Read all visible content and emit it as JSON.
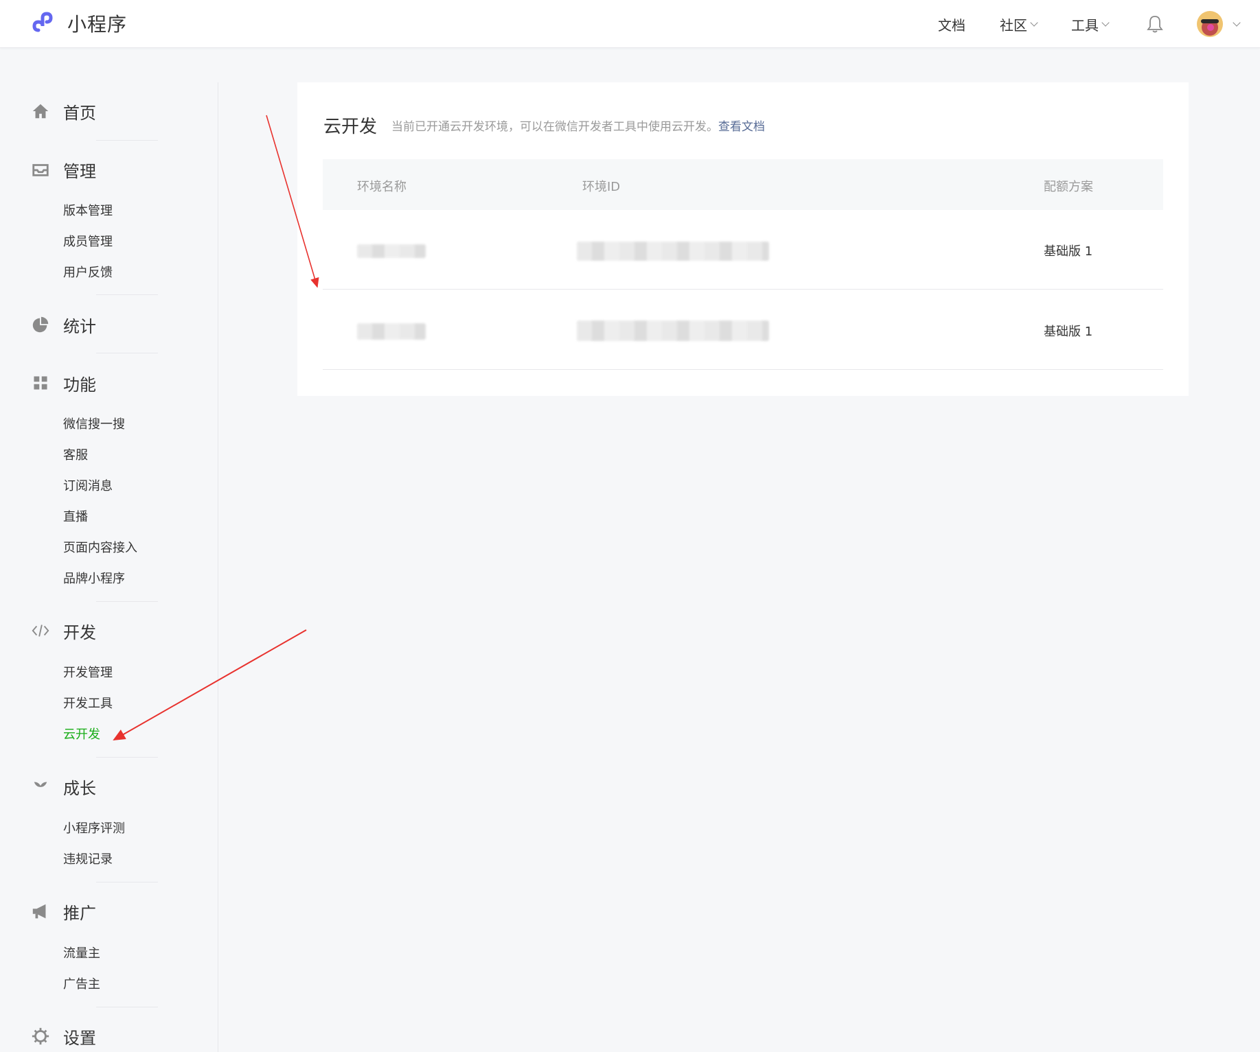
{
  "header": {
    "brand": "小程序",
    "nav": [
      {
        "label": "文档",
        "dropdown": false
      },
      {
        "label": "社区",
        "dropdown": true
      },
      {
        "label": "工具",
        "dropdown": true
      }
    ]
  },
  "sidebar": {
    "home": "首页",
    "manage": {
      "label": "管理",
      "items": [
        "版本管理",
        "成员管理",
        "用户反馈"
      ]
    },
    "stats": "统计",
    "features": {
      "label": "功能",
      "items": [
        "微信搜一搜",
        "客服",
        "订阅消息",
        "直播",
        "页面内容接入",
        "品牌小程序"
      ]
    },
    "dev": {
      "label": "开发",
      "items": [
        "开发管理",
        "开发工具",
        "云开发"
      ]
    },
    "growth": {
      "label": "成长",
      "items": [
        "小程序评测",
        "违规记录"
      ]
    },
    "promo": {
      "label": "推广",
      "items": [
        "流量主",
        "广告主"
      ]
    },
    "settings": "设置"
  },
  "panel": {
    "title": "云开发",
    "desc": "当前已开通云开发环境，可以在微信开发者工具中使用云开发。",
    "link": "查看文档",
    "columns": [
      "环境名称",
      "环境ID",
      "配额方案"
    ],
    "rows": [
      {
        "plan": "基础版 1"
      },
      {
        "plan": "基础版 1"
      }
    ]
  },
  "colors": {
    "accent_green": "#1aad19",
    "link": "#576b95",
    "brand": "#6467f0",
    "annotation_red": "#e8322e"
  }
}
